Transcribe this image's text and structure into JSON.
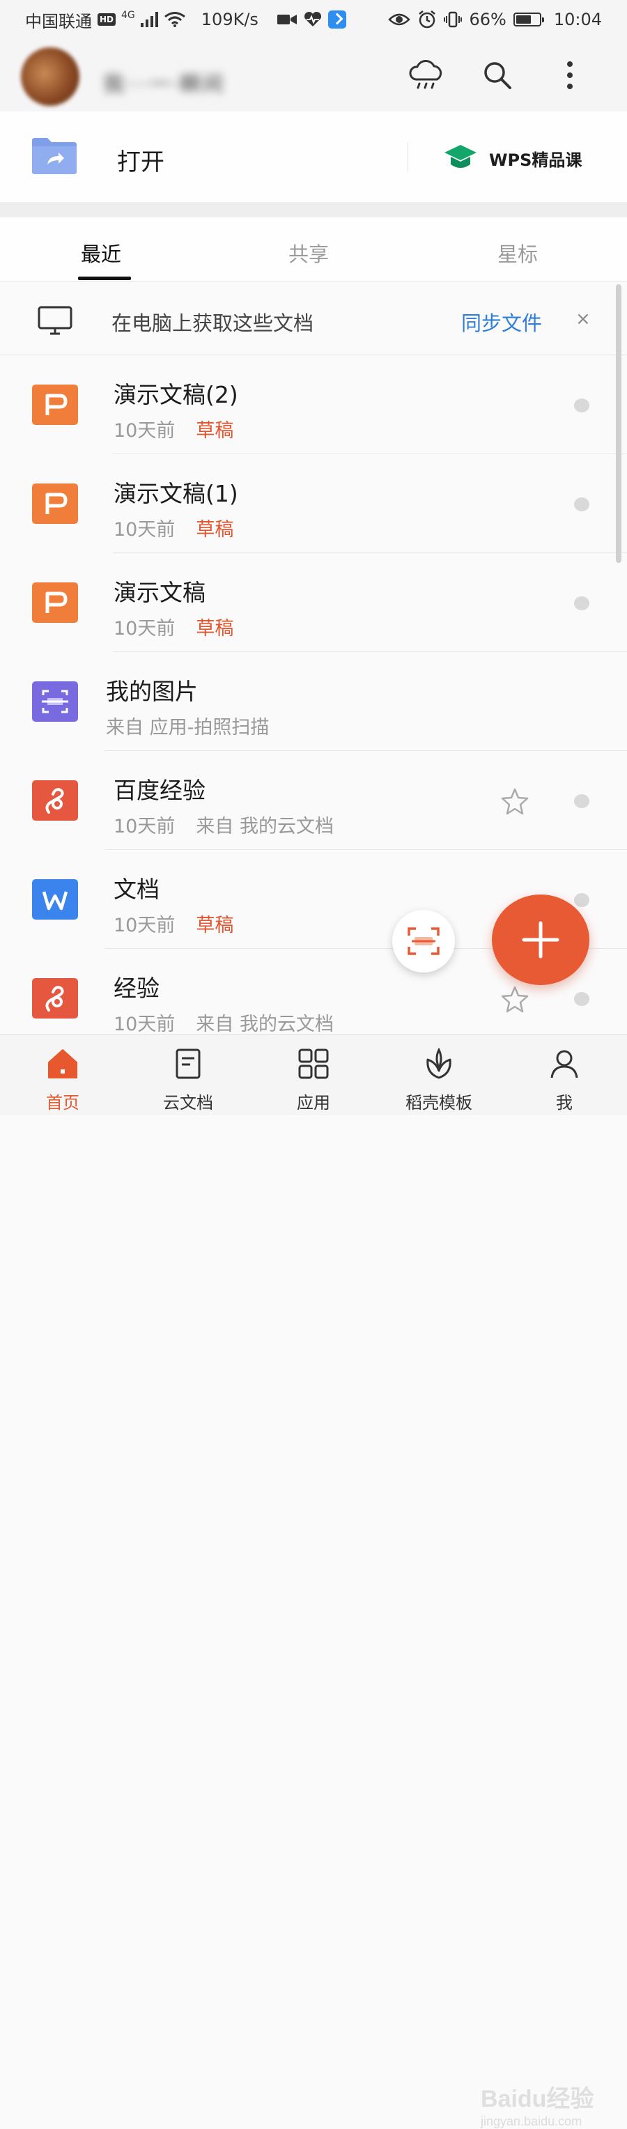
{
  "status_bar": {
    "carrier": "中国联通",
    "hd": "HD",
    "network": "4G",
    "speed": "109K/s",
    "battery": "66%",
    "battery_level": 0.66,
    "time": "10:04"
  },
  "header": {
    "username": "我···一·瞬间",
    "icons": [
      "cloud-rain-icon",
      "search-icon",
      "more-vert-icon"
    ]
  },
  "open_row": {
    "open_label": "打开",
    "course_label": "WPS精品课"
  },
  "tabs": [
    {
      "label": "最近",
      "active": true
    },
    {
      "label": "共享",
      "active": false
    },
    {
      "label": "星标",
      "active": false
    }
  ],
  "sync_banner": {
    "text": "在电脑上获取这些文档",
    "link": "同步文件",
    "close": "×"
  },
  "files": [
    {
      "name": "演示文稿(2)",
      "time": "10天前",
      "tag": "草稿",
      "source": "",
      "type": "presentation",
      "color": "#f07d3a",
      "starred_outline": false
    },
    {
      "name": "演示文稿(1)",
      "time": "10天前",
      "tag": "草稿",
      "source": "",
      "type": "presentation",
      "color": "#f07d3a",
      "starred_outline": false
    },
    {
      "name": "演示文稿",
      "time": "10天前",
      "tag": "草稿",
      "source": "",
      "type": "presentation",
      "color": "#f07d3a",
      "starred_outline": false
    },
    {
      "name": "我的图片",
      "time": "",
      "tag": "",
      "source": "来自 应用-拍照扫描",
      "type": "scan",
      "color": "#7a6ae0",
      "starred_outline": false
    },
    {
      "name": "百度经验",
      "time": "10天前",
      "tag": "",
      "source": "来自 我的云文档",
      "type": "pdf",
      "color": "#e6573f",
      "starred_outline": true
    },
    {
      "name": "文档",
      "time": "10天前",
      "tag": "草稿",
      "source": "",
      "type": "word",
      "color": "#3b84ee",
      "starred_outline": false
    },
    {
      "name": "经验",
      "time": "10天前",
      "tag": "",
      "source": "来自 我的云文档",
      "type": "pdf",
      "color": "#e6573f",
      "starred_outline": true
    }
  ],
  "bottom_nav": [
    {
      "label": "首页",
      "icon": "home-icon",
      "active": true
    },
    {
      "label": "云文档",
      "icon": "document-icon",
      "active": false
    },
    {
      "label": "应用",
      "icon": "apps-grid-icon",
      "active": false
    },
    {
      "label": "稻壳模板",
      "icon": "leaf-icon",
      "active": false
    },
    {
      "label": "我",
      "icon": "person-icon",
      "active": false
    }
  ],
  "watermark": {
    "brand": "Baidu经验",
    "url": "jingyan.baidu.com"
  },
  "colors": {
    "accent": "#e85a34",
    "link": "#2f7fd8",
    "draft": "#e0572f"
  }
}
